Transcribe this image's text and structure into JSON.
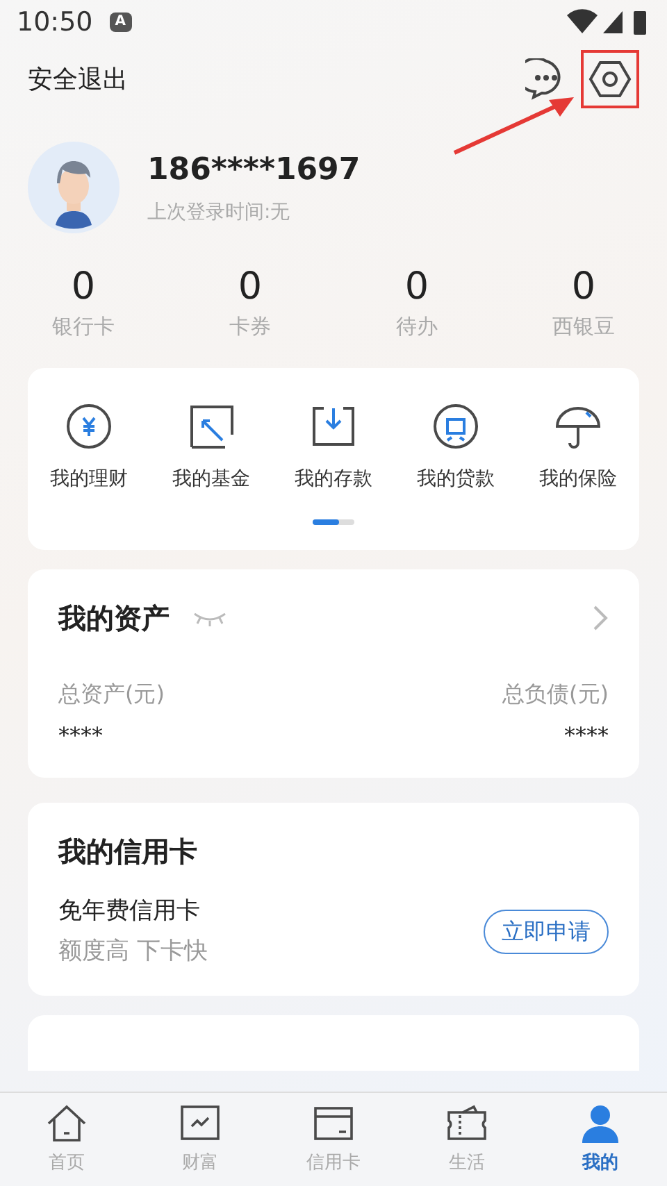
{
  "status_bar": {
    "time": "10:50",
    "badge": "A"
  },
  "header": {
    "logout": "安全退出"
  },
  "profile": {
    "phone": "186****1697",
    "last_login": "上次登录时间:无"
  },
  "stats": [
    {
      "value": "0",
      "label": "银行卡"
    },
    {
      "value": "0",
      "label": "卡券"
    },
    {
      "value": "0",
      "label": "待办"
    },
    {
      "value": "0",
      "label": "西银豆"
    }
  ],
  "shortcuts": [
    {
      "kind": "wealth",
      "label": "我的理财"
    },
    {
      "kind": "fund",
      "label": "我的基金"
    },
    {
      "kind": "deposit",
      "label": "我的存款"
    },
    {
      "kind": "loan",
      "label": "我的贷款"
    },
    {
      "kind": "insurance",
      "label": "我的保险"
    }
  ],
  "assets": {
    "title": "我的资产",
    "left_label": "总资产(元)",
    "left_value": "****",
    "right_label": "总负债(元)",
    "right_value": "****"
  },
  "credit": {
    "title": "我的信用卡",
    "product": "免年费信用卡",
    "subtitle": "额度高 下卡快",
    "button": "立即申请"
  },
  "nav": [
    {
      "kind": "home",
      "label": "首页",
      "selected": false
    },
    {
      "kind": "wealth",
      "label": "财富",
      "selected": false
    },
    {
      "kind": "card",
      "label": "信用卡",
      "selected": false
    },
    {
      "kind": "life",
      "label": "生活",
      "selected": false
    },
    {
      "kind": "me",
      "label": "我的",
      "selected": true
    }
  ]
}
